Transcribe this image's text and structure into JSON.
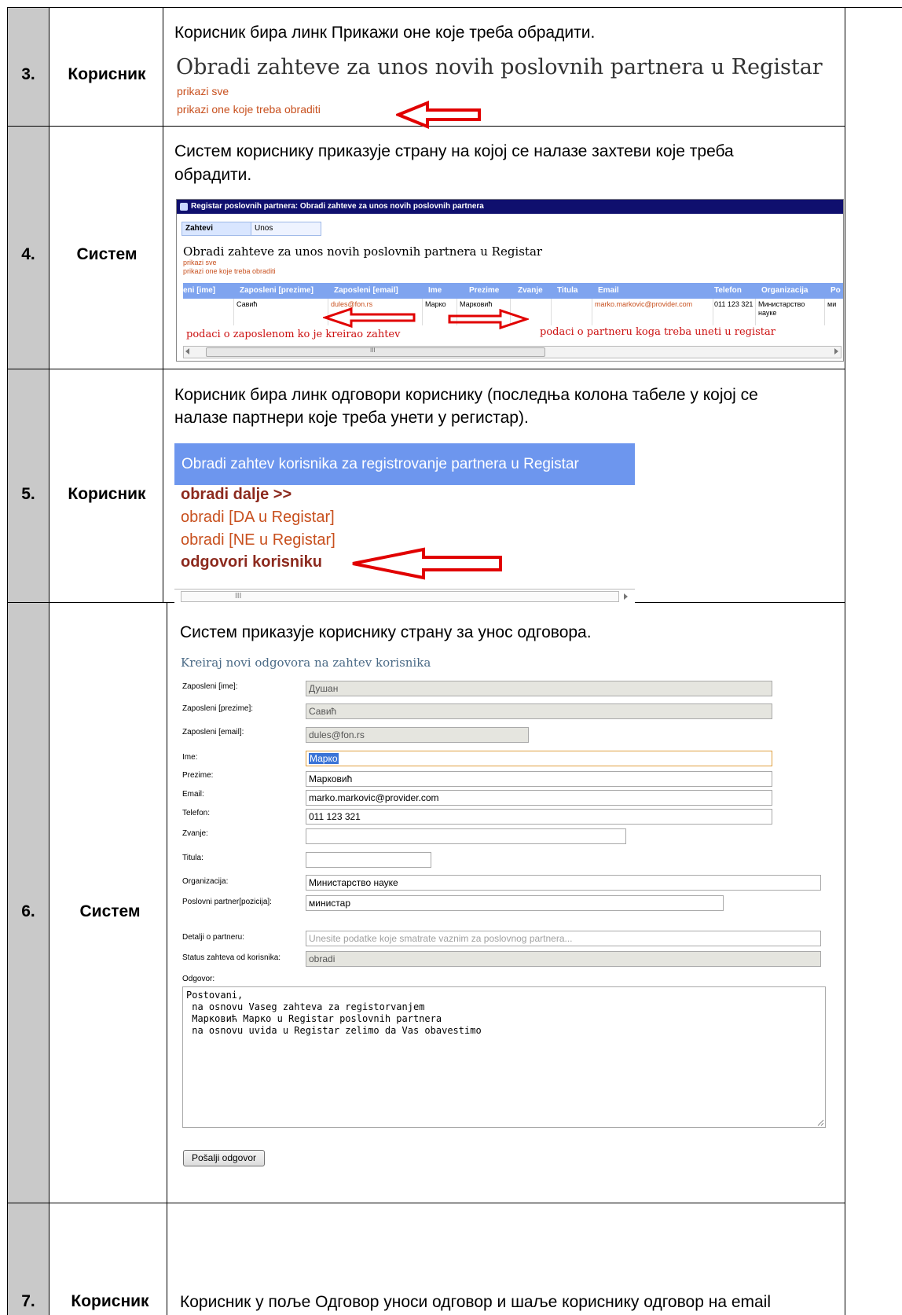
{
  "steps": {
    "s3": {
      "num": "3.",
      "actor": "Корисник",
      "desc": "Корисник бира линк Прикажи оне које треба обрадити.",
      "shot": {
        "title": "Obradi zahteve za unos novih poslovnih partnera u Registar",
        "link_all": "prikazi sve",
        "link_todo": "prikazi one koje treba obraditi"
      }
    },
    "s4": {
      "num": "4.",
      "actor": "Систем",
      "desc_line1": "Систем кориснику приказује страну на којој се налазе захтеви које треба",
      "desc_line2": "обрадити.",
      "shot": {
        "window_title": "Registar poslovnih partnera: Obradi zahteve za unos novih poslovnih partnera",
        "tab1": "Zahtevi",
        "tab2": "Unos",
        "heading": "Obradi zahteve za unos novih poslovnih partnera u Registar",
        "link_all": "prikazi sve",
        "link_todo": "prikazi one koje treba obraditi",
        "columns": [
          "eni [ime]",
          "Zaposleni [prezime]",
          "Zaposleni [email]",
          "Ime",
          "Prezime",
          "Zvanje",
          "Titula",
          "Email",
          "Telefon",
          "Organizacija",
          "Po"
        ],
        "row": {
          "prezime": "Савић",
          "email": "dules@fon.rs",
          "ime": "Марко",
          "partner_prezime": "Марковић",
          "partner_email": "marko.markovic@provider.com",
          "telefon": "011 123 321",
          "org_line1": "Министарство",
          "org_line2": "науке",
          "po": "ми"
        },
        "note_left": "podaci o zaposlenom ko je kreirao zahtev",
        "note_right": "podaci o partneru koga treba uneti u registar",
        "scroll_mark": "III"
      }
    },
    "s5": {
      "num": "5.",
      "actor": "Корисник",
      "desc_line1": "Корисник бира линк одговори кориснику (последња колона табеле у којој се",
      "desc_line2": "налазе партнери које треба унети у регистар).",
      "shot": {
        "header": "Obradi zahtev korisnika za registrovanje partnera u Registar",
        "link1": "obradi dalje >>",
        "link2": "obradi [DA u Registar]",
        "link3": "obradi [NE u Registar]",
        "link4": "odgovori korisniku",
        "scroll_mark": "III"
      }
    },
    "s6": {
      "num": "6.",
      "actor": "Систем",
      "desc": "Систем приказује кориснику страну за унос одговора.",
      "shot": {
        "title": "Kreiraj novi odgovora na zahtev korisnika",
        "labels": {
          "zap_ime": "Zaposleni [ime]:",
          "zap_prezime": "Zaposleni [prezime]:",
          "zap_email": "Zaposleni [email]:",
          "ime": "Ime:",
          "prezime": "Prezime:",
          "email": "Email:",
          "telefon": "Telefon:",
          "zvanje": "Zvanje:",
          "titula": "Titula:",
          "organizacija": "Organizacija:",
          "pozicija": "Poslovni partner[pozicija]:",
          "detalji": "Detalji o partneru:",
          "status": "Status zahteva od korisnika:",
          "odgovor": "Odgovor:"
        },
        "values": {
          "zap_ime": "Душан",
          "zap_prezime": "Савић",
          "zap_email": "dules@fon.rs",
          "ime": "Марко",
          "prezime": "Марковић",
          "email": "marko.markovic@provider.com",
          "telefon": "011 123 321",
          "zvanje": "",
          "titula": "",
          "organizacija": "Министарство науке",
          "pozicija": "министар",
          "detalji_placeholder": "Unesite podatke koje smatrate vaznim za poslovnog partnera...",
          "status": "obradi",
          "odgovor": "Postovani,\n na osnovu Vaseg zahteva za registorvanjem\n Марковић Марко u Registar poslovnih partnera\n na osnovu uvida u Registar zelimo da Vas obavestimo"
        },
        "button": "Pošalji odgovor"
      }
    },
    "s7": {
      "num": "7.",
      "actor": "Корисник",
      "desc": "Корисник у поље Одговор уноси одговор и шаље кориснику одговор на email"
    }
  }
}
